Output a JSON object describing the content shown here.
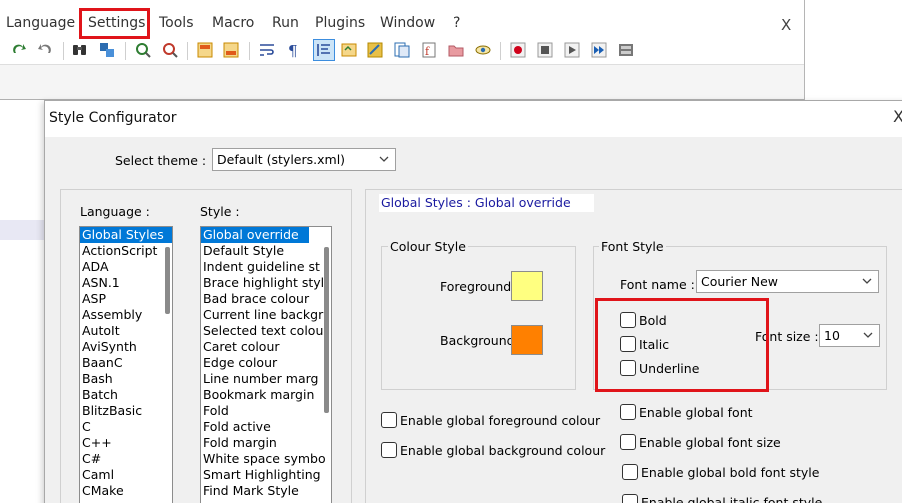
{
  "menubar": {
    "items": [
      "Language",
      "Settings",
      "Tools",
      "Macro",
      "Run",
      "Plugins",
      "Window",
      "?"
    ],
    "close_label": "X"
  },
  "toolbar": {
    "icons": [
      "redo-icon",
      "undo-icon",
      "find-icon",
      "replace-icon",
      "zoom-in-icon",
      "zoom-out-icon",
      "sync-vertical-icon",
      "sync-horizontal-icon",
      "word-wrap-icon",
      "show-all-characters-icon",
      "indent-guide-icon",
      "user-defined-language-icon",
      "document-map-icon",
      "document-list-icon",
      "function-list-icon",
      "folder-as-workspace-icon",
      "monitoring-icon",
      "record-macro-icon",
      "stop-recording-icon",
      "playback-macro-icon",
      "run-macro-multiple-icon",
      "save-macro-icon"
    ]
  },
  "dialog": {
    "title": "Style Configurator",
    "close_label": "X",
    "select_theme_label": "Select theme :",
    "theme_value": "Default (stylers.xml)",
    "language_label": "Language :",
    "style_label": "Style :",
    "languages": [
      "Global Styles",
      "ActionScript",
      "ADA",
      "ASN.1",
      "ASP",
      "Assembly",
      "AutoIt",
      "AviSynth",
      "BaanC",
      "Bash",
      "Batch",
      "BlitzBasic",
      "C",
      "C++",
      "C#",
      "Caml",
      "CMake"
    ],
    "selected_language": "Global Styles",
    "styles": [
      "Global override",
      "Default Style",
      "Indent guideline st",
      "Brace highlight styl",
      "Bad brace colour",
      "Current line backgr",
      "Selected text colou",
      "Caret colour",
      "Edge colour",
      "Line number marg",
      "Bookmark margin",
      "Fold",
      "Fold active",
      "Fold margin",
      "White space symbo",
      "Smart Highlighting",
      "Find Mark Style"
    ],
    "selected_style": "Global override",
    "header_text": "Global Styles : Global override",
    "colour_style": {
      "title": "Colour Style",
      "foreground_label": "Foreground",
      "foreground_color": "#ffff80",
      "background_label": "Background",
      "background_color": "#ff8000"
    },
    "font_style": {
      "title": "Font Style",
      "font_name_label": "Font name :",
      "font_name_value": "Courier New",
      "font_size_label": "Font size :",
      "font_size_value": "10",
      "bold_label": "Bold",
      "italic_label": "Italic",
      "underline_label": "Underline"
    },
    "global_options": {
      "enable_fg": "Enable global foreground colour",
      "enable_bg": "Enable global background colour",
      "enable_font": "Enable global font",
      "enable_font_size": "Enable global font size",
      "enable_bold": "Enable global bold font style",
      "enable_italic": "Enable global italic font style"
    }
  },
  "colors": {
    "highlight_red": "#e0141a",
    "selection_blue": "#0078d7",
    "header_text_blue": "#1a1aa0"
  }
}
